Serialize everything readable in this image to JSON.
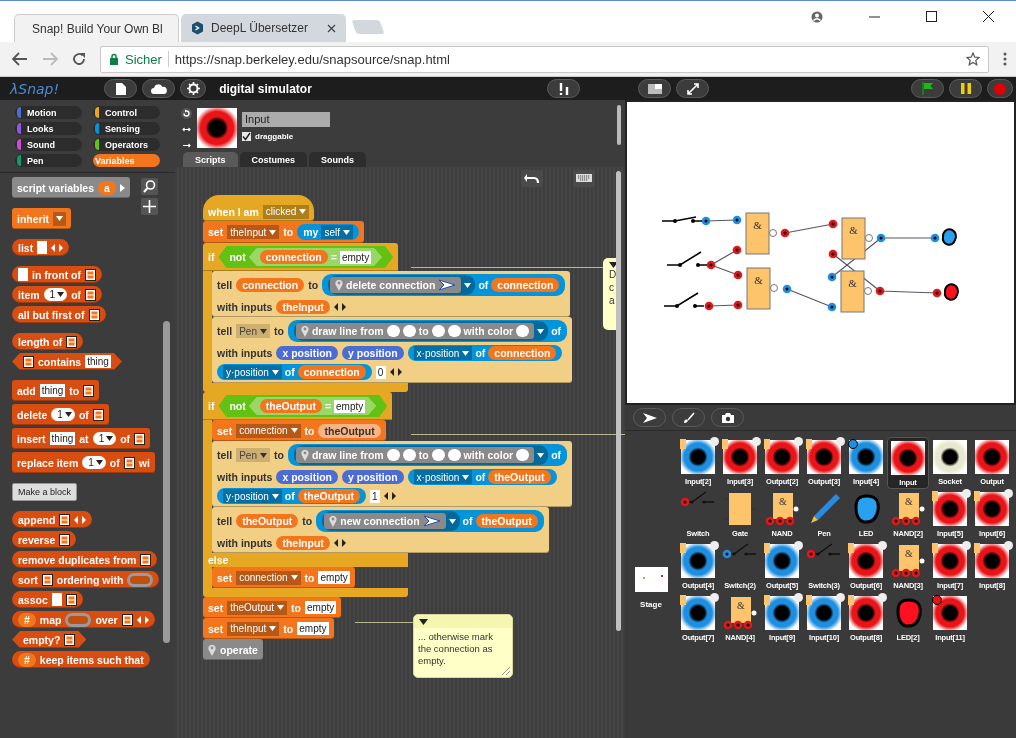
{
  "browser": {
    "tabs": [
      {
        "title": "Snap! Build Your Own Bl",
        "selected": true
      },
      {
        "title": "DeepL Übersetzer",
        "selected": false
      }
    ],
    "security_label": "Sicher",
    "url": "https://snap.berkeley.edu/snapsource/snap.html"
  },
  "topbar": {
    "logo": "λSnap!",
    "project_title": "digital simulator"
  },
  "categories": [
    {
      "name": "Motion",
      "color": "#4a6cd4",
      "selected": false
    },
    {
      "name": "Control",
      "color": "#e6a822",
      "selected": false
    },
    {
      "name": "Looks",
      "color": "#8f56e3",
      "selected": false
    },
    {
      "name": "Sensing",
      "color": "#0494dc",
      "selected": false
    },
    {
      "name": "Sound",
      "color": "#cf4ad9",
      "selected": false
    },
    {
      "name": "Operators",
      "color": "#62c213",
      "selected": false
    },
    {
      "name": "Pen",
      "color": "#0e9a6c",
      "selected": false
    },
    {
      "name": "Variables",
      "color": "#f3761d",
      "selected": true
    }
  ],
  "palette": {
    "groups": [
      [
        {
          "kind": "command",
          "color": "#8a8a8a",
          "lines": [
            [
              {
                "kind": "text",
                "text": "script variables"
              },
              {
                "kind": "var",
                "text": "a"
              },
              {
                "kind": "arrow_right"
              }
            ]
          ]
        }
      ],
      [
        {
          "kind": "command",
          "color": "#f3761d",
          "lines": [
            [
              {
                "kind": "text",
                "text": "inherit"
              },
              {
                "kind": "dropdown"
              }
            ]
          ]
        }
      ],
      [
        {
          "kind": "reporter",
          "color": "#d94d11",
          "lines": [
            [
              {
                "kind": "text",
                "text": "list"
              },
              {
                "kind": "slot"
              },
              {
                "kind": "arrows"
              }
            ]
          ]
        }
      ],
      [
        {
          "kind": "reporter",
          "color": "#d94d11",
          "lines": [
            [
              {
                "kind": "slot"
              },
              {
                "kind": "text",
                "text": "in front of"
              },
              {
                "kind": "list"
              }
            ]
          ]
        },
        {
          "kind": "reporter",
          "color": "#d94d11",
          "lines": [
            [
              {
                "kind": "text",
                "text": "item"
              },
              {
                "kind": "num",
                "text": "1"
              },
              {
                "kind": "text",
                "text": "of"
              },
              {
                "kind": "list"
              }
            ]
          ]
        },
        {
          "kind": "reporter",
          "color": "#d94d11",
          "lines": [
            [
              {
                "kind": "text",
                "text": "all but first of"
              },
              {
                "kind": "list"
              }
            ]
          ]
        }
      ],
      [
        {
          "kind": "reporter",
          "color": "#d94d11",
          "lines": [
            [
              {
                "kind": "text",
                "text": "length of"
              },
              {
                "kind": "list"
              }
            ]
          ]
        },
        {
          "kind": "predicate",
          "color": "#d94d11",
          "lines": [
            [
              {
                "kind": "list"
              },
              {
                "kind": "text",
                "text": "contains"
              },
              {
                "kind": "slot",
                "text": "thing"
              }
            ]
          ]
        }
      ],
      [
        {
          "kind": "command",
          "color": "#d94d11",
          "lines": [
            [
              {
                "kind": "text",
                "text": "add"
              },
              {
                "kind": "slot",
                "text": "thing"
              },
              {
                "kind": "text",
                "text": "to"
              },
              {
                "kind": "list"
              }
            ]
          ]
        },
        {
          "kind": "command",
          "color": "#d94d11",
          "lines": [
            [
              {
                "kind": "text",
                "text": "delete"
              },
              {
                "kind": "num",
                "text": "1"
              },
              {
                "kind": "text",
                "text": "of"
              },
              {
                "kind": "list"
              }
            ]
          ]
        },
        {
          "kind": "command",
          "color": "#d94d11",
          "lines": [
            [
              {
                "kind": "text",
                "text": "insert"
              },
              {
                "kind": "slot",
                "text": "thing"
              },
              {
                "kind": "text",
                "text": "at"
              },
              {
                "kind": "num",
                "text": "1"
              },
              {
                "kind": "text",
                "text": "of"
              },
              {
                "kind": "list"
              }
            ]
          ]
        },
        {
          "kind": "command",
          "color": "#d94d11",
          "lines": [
            [
              {
                "kind": "text",
                "text": "replace item"
              },
              {
                "kind": "num",
                "text": "1"
              },
              {
                "kind": "text",
                "text": "of"
              },
              {
                "kind": "list"
              },
              {
                "kind": "text",
                "text": "wi"
              }
            ]
          ]
        }
      ],
      [
        {
          "kind": "button",
          "text": "Make a block"
        }
      ],
      [
        {
          "kind": "reporter",
          "color": "#d94d11",
          "lines": [
            [
              {
                "kind": "text",
                "text": "append"
              },
              {
                "kind": "list"
              },
              {
                "kind": "arrows"
              }
            ]
          ]
        },
        {
          "kind": "reporter",
          "color": "#d94d11",
          "lines": [
            [
              {
                "kind": "text",
                "text": "reverse"
              },
              {
                "kind": "list"
              }
            ]
          ]
        },
        {
          "kind": "reporter",
          "color": "#d94d11",
          "lines": [
            [
              {
                "kind": "text",
                "text": "remove duplicates from"
              },
              {
                "kind": "list"
              }
            ]
          ]
        },
        {
          "kind": "reporter",
          "color": "#d94d11",
          "lines": [
            [
              {
                "kind": "text",
                "text": "sort"
              },
              {
                "kind": "list"
              },
              {
                "kind": "text",
                "text": "ordering with"
              },
              {
                "kind": "ring"
              }
            ]
          ]
        },
        {
          "kind": "reporter",
          "color": "#d94d11",
          "lines": [
            [
              {
                "kind": "text",
                "text": "assoc"
              },
              {
                "kind": "slot"
              },
              {
                "kind": "list"
              }
            ]
          ]
        },
        {
          "kind": "reporter",
          "color": "#d94d11",
          "lines": [
            [
              {
                "kind": "var",
                "text": "#"
              },
              {
                "kind": "text",
                "text": "map"
              },
              {
                "kind": "ring"
              },
              {
                "kind": "text",
                "text": "over"
              },
              {
                "kind": "list"
              },
              {
                "kind": "arrows"
              }
            ]
          ]
        },
        {
          "kind": "predicate",
          "color": "#d94d11",
          "lines": [
            [
              {
                "kind": "text",
                "text": "empty?"
              },
              {
                "kind": "list"
              }
            ]
          ]
        },
        {
          "kind": "reporter",
          "color": "#d94d11",
          "lines": [
            [
              {
                "kind": "var",
                "text": "#"
              },
              {
                "kind": "text",
                "text": "keep items such that"
              }
            ]
          ]
        }
      ]
    ]
  },
  "sprite": {
    "name": "Input",
    "draggable_label": "draggable",
    "draggable": true
  },
  "editor_tabs": [
    {
      "label": "Scripts",
      "selected": true
    },
    {
      "label": "Costumes",
      "selected": false
    },
    {
      "label": "Sounds",
      "selected": false
    }
  ],
  "script": [
    {
      "kind": "hat",
      "color": "#e6a822",
      "lines": [
        [
          {
            "kind": "text",
            "text": "when I am"
          },
          {
            "kind": "dropdown",
            "text": "clicked"
          }
        ]
      ]
    },
    {
      "kind": "command",
      "color": "#f3761d",
      "lines": [
        [
          {
            "kind": "text",
            "text": "set"
          },
          {
            "kind": "dropdown",
            "text": "theInput"
          },
          {
            "kind": "text",
            "text": "to"
          },
          {
            "kind": "reporter",
            "color": "#0494dc",
            "parts": [
              {
                "kind": "text",
                "text": "my"
              },
              {
                "kind": "dropdown",
                "text": "self"
              }
            ]
          }
        ]
      ]
    },
    {
      "kind": "c",
      "color": "#e6a822",
      "lines": [
        [
          {
            "kind": "text",
            "text": "if"
          },
          {
            "kind": "predicate",
            "color": "#62c213",
            "parts": [
              {
                "kind": "text",
                "text": "not"
              },
              {
                "kind": "predicate",
                "color": "#99d766",
                "parts": [
                  {
                    "kind": "var",
                    "text": "connection"
                  },
                  {
                    "kind": "text",
                    "text": "="
                  },
                  {
                    "kind": "slot",
                    "text": "empty"
                  }
                ]
              }
            ]
          }
        ]
      ],
      "children": [
        {
          "kind": "command",
          "color": "#f1cf85",
          "lines": [
            [
              {
                "kind": "text",
                "text": "tell"
              },
              {
                "kind": "var",
                "text": "connection"
              },
              {
                "kind": "text",
                "text": "to"
              },
              {
                "kind": "reporter",
                "color": "#0494dc",
                "parts": [
                  {
                    "kind": "ring",
                    "block": [
                      {
                        "kind": "pin"
                      },
                      {
                        "kind": "text",
                        "text": "delete connection"
                      },
                      {
                        "kind": "arrow_icon"
                      }
                    ]
                  },
                  {
                    "kind": "text",
                    "text": "of"
                  },
                  {
                    "kind": "var",
                    "text": "connection"
                  }
                ]
              }
            ],
            [
              {
                "kind": "text",
                "text": "with inputs"
              },
              {
                "kind": "var",
                "text": "theInput"
              },
              {
                "kind": "arrows"
              }
            ]
          ]
        },
        {
          "kind": "command",
          "color": "#f1cf85",
          "lines": [
            [
              {
                "kind": "text",
                "text": "tell"
              },
              {
                "kind": "dropdown",
                "text": "Pen"
              },
              {
                "kind": "text",
                "text": "to"
              },
              {
                "kind": "reporter",
                "color": "#0494dc",
                "parts": [
                  {
                    "kind": "ring",
                    "block": [
                      {
                        "kind": "pin"
                      },
                      {
                        "kind": "text",
                        "text": "draw line from"
                      },
                      {
                        "kind": "round"
                      },
                      {
                        "kind": "round"
                      },
                      {
                        "kind": "text",
                        "text": "to"
                      },
                      {
                        "kind": "round"
                      },
                      {
                        "kind": "round"
                      },
                      {
                        "kind": "text",
                        "text": "with color"
                      },
                      {
                        "kind": "round"
                      }
                    ]
                  },
                  {
                    "kind": "text",
                    "text": "of"
                  }
                ]
              }
            ],
            [
              {
                "kind": "text",
                "text": "with inputs"
              },
              {
                "kind": "reporter",
                "color": "#4a6cd4",
                "parts": [
                  {
                    "kind": "text",
                    "text": "x position"
                  }
                ]
              },
              {
                "kind": "reporter",
                "color": "#4a6cd4",
                "parts": [
                  {
                    "kind": "text",
                    "text": "y position"
                  }
                ]
              },
              {
                "kind": "reporter",
                "color": "#0494dc",
                "parts": [
                  {
                    "kind": "dropdown",
                    "text": "x·position"
                  },
                  {
                    "kind": "text",
                    "text": "of"
                  },
                  {
                    "kind": "var",
                    "text": "connection"
                  }
                ]
              }
            ],
            [
              {
                "kind": "reporter",
                "color": "#0494dc",
                "parts": [
                  {
                    "kind": "dropdown",
                    "text": "y·position"
                  },
                  {
                    "kind": "text",
                    "text": "of"
                  },
                  {
                    "kind": "var",
                    "text": "connection"
                  }
                ]
              },
              {
                "kind": "slot",
                "text": "0"
              },
              {
                "kind": "arrows"
              }
            ]
          ]
        }
      ]
    },
    {
      "kind": "c",
      "color": "#e6a822",
      "lines": [
        [
          {
            "kind": "text",
            "text": "if"
          },
          {
            "kind": "predicate",
            "color": "#62c213",
            "parts": [
              {
                "kind": "text",
                "text": "not"
              },
              {
                "kind": "predicate",
                "color": "#99d766",
                "parts": [
                  {
                    "kind": "var",
                    "text": "theOutput"
                  },
                  {
                    "kind": "text",
                    "text": "="
                  },
                  {
                    "kind": "slot",
                    "text": "empty"
                  }
                ]
              }
            ]
          }
        ]
      ],
      "children": [
        {
          "kind": "command",
          "color": "#f3761d",
          "lines": [
            [
              {
                "kind": "text",
                "text": "set"
              },
              {
                "kind": "dropdown",
                "text": "connection"
              },
              {
                "kind": "text",
                "text": "to"
              },
              {
                "kind": "var",
                "text": "theOutput"
              }
            ]
          ]
        },
        {
          "kind": "command",
          "color": "#f1cf85",
          "lines": [
            [
              {
                "kind": "text",
                "text": "tell"
              },
              {
                "kind": "dropdown",
                "text": "Pen"
              },
              {
                "kind": "text",
                "text": "to"
              },
              {
                "kind": "reporter",
                "color": "#0494dc",
                "parts": [
                  {
                    "kind": "ring",
                    "block": [
                      {
                        "kind": "pin"
                      },
                      {
                        "kind": "text",
                        "text": "draw line from"
                      },
                      {
                        "kind": "round"
                      },
                      {
                        "kind": "round"
                      },
                      {
                        "kind": "text",
                        "text": "to"
                      },
                      {
                        "kind": "round"
                      },
                      {
                        "kind": "round"
                      },
                      {
                        "kind": "text",
                        "text": "with color"
                      },
                      {
                        "kind": "round"
                      }
                    ]
                  },
                  {
                    "kind": "text",
                    "text": "of"
                  }
                ]
              }
            ],
            [
              {
                "kind": "text",
                "text": "with inputs"
              },
              {
                "kind": "reporter",
                "color": "#4a6cd4",
                "parts": [
                  {
                    "kind": "text",
                    "text": "x position"
                  }
                ]
              },
              {
                "kind": "reporter",
                "color": "#4a6cd4",
                "parts": [
                  {
                    "kind": "text",
                    "text": "y position"
                  }
                ]
              },
              {
                "kind": "reporter",
                "color": "#0494dc",
                "parts": [
                  {
                    "kind": "dropdown",
                    "text": "x·position"
                  },
                  {
                    "kind": "text",
                    "text": "of"
                  },
                  {
                    "kind": "var",
                    "text": "theOutput"
                  }
                ]
              }
            ],
            [
              {
                "kind": "reporter",
                "color": "#0494dc",
                "parts": [
                  {
                    "kind": "dropdown",
                    "text": "y·position"
                  },
                  {
                    "kind": "text",
                    "text": "of"
                  },
                  {
                    "kind": "var",
                    "text": "theOutput"
                  }
                ]
              },
              {
                "kind": "slot",
                "text": "1"
              },
              {
                "kind": "arrows"
              }
            ]
          ]
        },
        {
          "kind": "command",
          "color": "#f1cf85",
          "lines": [
            [
              {
                "kind": "text",
                "text": "tell"
              },
              {
                "kind": "var",
                "text": "theOutput"
              },
              {
                "kind": "text",
                "text": "to"
              },
              {
                "kind": "reporter",
                "color": "#0494dc",
                "parts": [
                  {
                    "kind": "ring",
                    "block": [
                      {
                        "kind": "pin"
                      },
                      {
                        "kind": "text",
                        "text": "new connection"
                      },
                      {
                        "kind": "arrow_icon"
                      }
                    ]
                  },
                  {
                    "kind": "text",
                    "text": "of"
                  },
                  {
                    "kind": "var",
                    "text": "theOutput"
                  }
                ]
              }
            ],
            [
              {
                "kind": "text",
                "text": "with inputs"
              },
              {
                "kind": "var",
                "text": "theInput"
              },
              {
                "kind": "arrows"
              }
            ]
          ]
        }
      ],
      "else_label": "else",
      "else_children": [
        {
          "kind": "command",
          "color": "#f3761d",
          "lines": [
            [
              {
                "kind": "text",
                "text": "set"
              },
              {
                "kind": "dropdown",
                "text": "connection"
              },
              {
                "kind": "text",
                "text": "to"
              },
              {
                "kind": "slot",
                "text": "empty"
              }
            ]
          ]
        }
      ]
    },
    {
      "kind": "command",
      "color": "#f3761d",
      "lines": [
        [
          {
            "kind": "text",
            "text": "set"
          },
          {
            "kind": "dropdown",
            "text": "theOutput"
          },
          {
            "kind": "text",
            "text": "to"
          },
          {
            "kind": "slot",
            "text": "empty"
          }
        ]
      ]
    },
    {
      "kind": "command",
      "color": "#f3761d",
      "lines": [
        [
          {
            "kind": "text",
            "text": "set"
          },
          {
            "kind": "dropdown",
            "text": "theInput"
          },
          {
            "kind": "text",
            "text": "to"
          },
          {
            "kind": "slot",
            "text": "empty"
          }
        ]
      ]
    },
    {
      "kind": "command",
      "color": "#8a8a8a",
      "lines": [
        [
          {
            "kind": "pin"
          },
          {
            "kind": "text",
            "text": "operate"
          }
        ]
      ]
    }
  ],
  "comments": [
    {
      "lines": [
        "D",
        "c",
        "a"
      ]
    },
    {
      "lines": [
        "... otherwise mark",
        "the connection as",
        "empty."
      ]
    }
  ],
  "stage": {
    "gates": [
      {
        "label": "&"
      },
      {
        "label": "&"
      },
      {
        "label": "&"
      },
      {
        "label": "&"
      }
    ],
    "switches": [
      {
        "closed": true
      },
      {
        "closed": false
      },
      {
        "closed": false
      }
    ],
    "leds": [
      {
        "color": "#2aa0f0"
      },
      {
        "color": "#ff1020"
      }
    ]
  },
  "corral": {
    "stage_label": "Stage",
    "sprites": [
      {
        "name": "Input[2]",
        "kind": "ring",
        "color": "#1e8fe0",
        "attached": true,
        "selected": false
      },
      {
        "name": "Input[3]",
        "kind": "ring",
        "color": "#e81418",
        "attached": true,
        "selected": false
      },
      {
        "name": "Output[2]",
        "kind": "ring",
        "color": "#e81418",
        "attached": true,
        "selected": false
      },
      {
        "name": "Output[3]",
        "kind": "ring",
        "color": "#e81418",
        "attached": true,
        "selected": false
      },
      {
        "name": "Input[4]",
        "kind": "ring",
        "color": "#1e8fe0",
        "attached": false,
        "badge": {
          "color": "#1e8fe0"
        },
        "selected": false
      },
      {
        "name": "Input",
        "kind": "ring",
        "color": "#e81418",
        "attached": false,
        "selected": true
      },
      {
        "name": "Socket",
        "kind": "ring",
        "color": "#e8e8d0",
        "attached": false,
        "selected": false
      },
      {
        "name": "Output",
        "kind": "ring",
        "color": "#e81418",
        "attached": false,
        "selected": false
      },
      {
        "name": "Switch",
        "kind": "switch",
        "color": "#e81418",
        "attached": false,
        "selected": false
      },
      {
        "name": "Gate",
        "kind": "gate",
        "attached": false,
        "selected": false
      },
      {
        "name": "NAND",
        "kind": "nand",
        "symbol": "&",
        "attached": false,
        "selected": false
      },
      {
        "name": "Pen",
        "kind": "pen",
        "attached": false,
        "selected": false
      },
      {
        "name": "LED",
        "kind": "led",
        "color": "#2aa0f0",
        "attached": false,
        "selected": false
      },
      {
        "name": "NAND[2]",
        "kind": "nand",
        "symbol": "&",
        "attached": false,
        "selected": false
      },
      {
        "name": "Input[5]",
        "kind": "ring",
        "color": "#e81418",
        "attached": true,
        "selected": false
      },
      {
        "name": "Input[6]",
        "kind": "ring",
        "color": "#e81418",
        "attached": true,
        "selected": false
      },
      {
        "name": "Output[4]",
        "kind": "ring",
        "color": "#1e8fe0",
        "attached": true,
        "selected": false
      },
      {
        "name": "Switch(2)",
        "kind": "switch",
        "color": "#1e8fe0",
        "attached": false,
        "selected": false
      },
      {
        "name": "Output[5]",
        "kind": "ring",
        "color": "#1e8fe0",
        "attached": true,
        "selected": false
      },
      {
        "name": "Switch(3)",
        "kind": "switch",
        "color": "#e81418",
        "attached": false,
        "selected": false
      },
      {
        "name": "Output[6]",
        "kind": "ring",
        "color": "#e81418",
        "attached": true,
        "selected": false
      },
      {
        "name": "NAND[3]",
        "kind": "nand",
        "symbol": "&",
        "attached": false,
        "selected": false
      },
      {
        "name": "Input[7]",
        "kind": "ring",
        "color": "#e81418",
        "attached": true,
        "selected": false
      },
      {
        "name": "Input[8]",
        "kind": "ring",
        "color": "#e81418",
        "attached": true,
        "selected": false
      },
      {
        "name": "Output[7]",
        "kind": "ring",
        "color": "#1e8fe0",
        "attached": true,
        "selected": false
      },
      {
        "name": "NAND[4]",
        "kind": "nand",
        "symbol": "&",
        "attached": false,
        "selected": false
      },
      {
        "name": "Input[9]",
        "kind": "ring",
        "color": "#1e8fe0",
        "attached": true,
        "selected": false
      },
      {
        "name": "Input[10]",
        "kind": "ring",
        "color": "#1e8fe0",
        "attached": true,
        "selected": false
      },
      {
        "name": "Output[8]",
        "kind": "ring",
        "color": "#e81418",
        "attached": true,
        "selected": false
      },
      {
        "name": "LED[2]",
        "kind": "led",
        "color": "#ff1020",
        "attached": false,
        "selected": false
      },
      {
        "name": "Input[11]",
        "kind": "ring",
        "color": "#e81418",
        "attached": false,
        "badge": {
          "color": "#e81418"
        },
        "selected": false
      }
    ]
  }
}
